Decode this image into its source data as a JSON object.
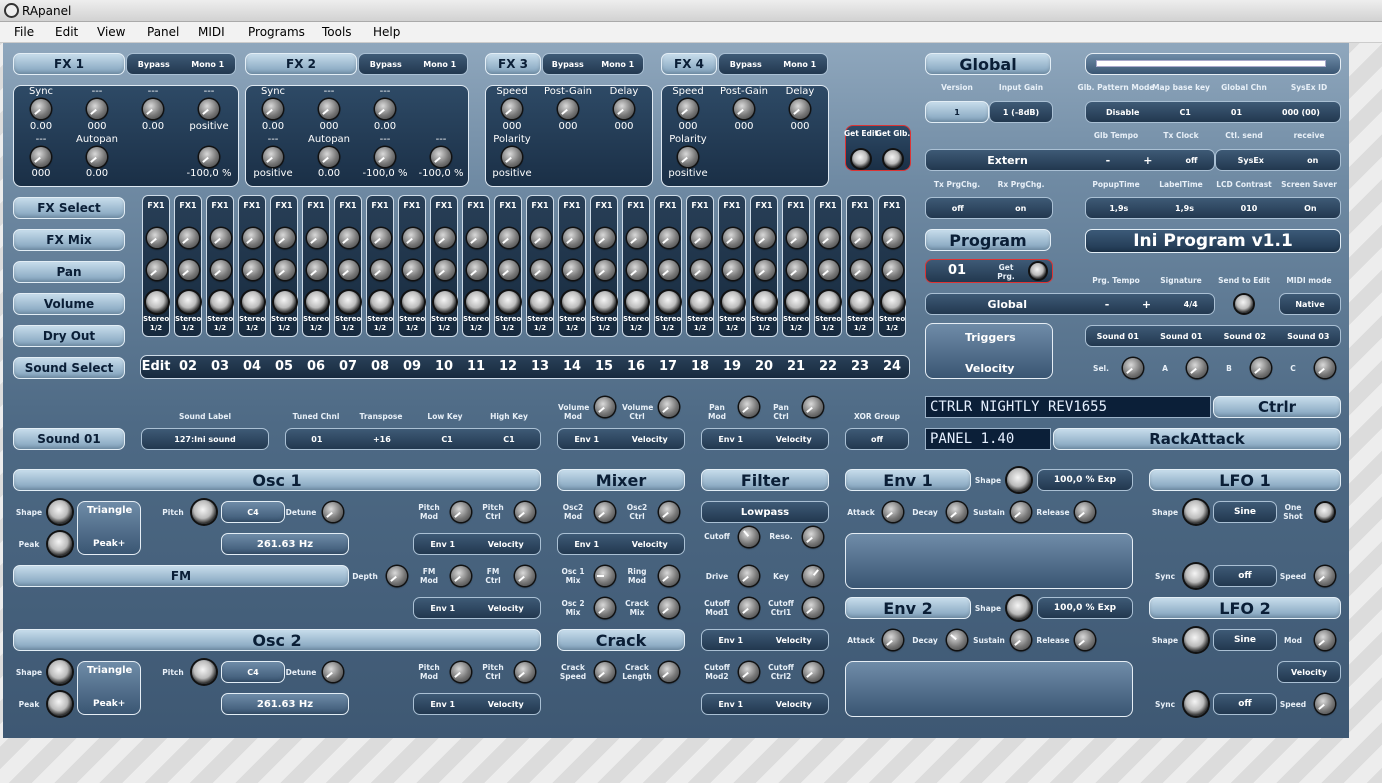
{
  "window": {
    "title": "RApanel"
  },
  "menu": [
    "File",
    "Edit",
    "View",
    "Panel",
    "MIDI",
    "Programs",
    "Tools",
    "Help"
  ],
  "fx": {
    "fx1": {
      "title": "FX 1",
      "bypass": "Bypass",
      "mono": "Mono 1",
      "labels_row1": [
        "Sync",
        "---",
        "---",
        "---"
      ],
      "values_row1": [
        "0.00",
        "000",
        "0.00",
        "positive"
      ],
      "labels_row2": [
        "---",
        "Autopan",
        "",
        ""
      ],
      "values_row2": [
        "000",
        "0.00",
        "",
        "-100,0 %"
      ]
    },
    "fx2": {
      "title": "FX 2",
      "bypass": "Bypass",
      "mono": "Mono 1",
      "labels_row1": [
        "Sync",
        "---",
        "---"
      ],
      "values_row1": [
        "0.00",
        "000",
        "0.00"
      ],
      "labels_row2": [
        "---",
        "Autopan",
        "---",
        "---"
      ],
      "values_row2": [
        "positive",
        "0.00",
        "-100,0 %",
        "-100,0 %"
      ]
    },
    "fx3": {
      "title": "FX 3",
      "bypass": "Bypass",
      "mono": "Mono 1",
      "labels": [
        "Speed",
        "Post-Gain",
        "Delay"
      ],
      "values": [
        "000",
        "000",
        "000"
      ],
      "polarity_label": "Polarity",
      "polarity_value": "positive"
    },
    "fx4": {
      "title": "FX 4",
      "bypass": "Bypass",
      "mono": "Mono 1",
      "labels": [
        "Speed",
        "Post-Gain",
        "Delay"
      ],
      "values": [
        "000",
        "000",
        "000"
      ],
      "polarity_label": "Polarity",
      "polarity_value": "positive"
    },
    "get_edit": "Get Edit",
    "get_glb": "Get Glb."
  },
  "mixer_buttons": [
    "FX Select",
    "FX Mix",
    "Pan",
    "Volume",
    "Dry Out",
    "Sound Select"
  ],
  "strip": {
    "fx_label": "FX1",
    "stereo": "Stereo",
    "half": "1/2",
    "numbers": [
      "Edit",
      "02",
      "03",
      "04",
      "05",
      "06",
      "07",
      "08",
      "09",
      "10",
      "11",
      "12",
      "13",
      "14",
      "15",
      "16",
      "17",
      "18",
      "19",
      "20",
      "21",
      "22",
      "23",
      "24"
    ]
  },
  "global": {
    "title": "Global",
    "version_label": "Version",
    "version": "1",
    "input_gain_label": "Input Gain",
    "input_gain": "1 (-8dB)",
    "glb_pattern_mode_label": "Glb. Pattern Mode",
    "glb_pattern_mode": "Disable",
    "map_base_key_label": "Map base key",
    "map_base_key": "C1",
    "global_chn_label": "Global Chn",
    "global_chn": "01",
    "sysex_id_label": "SysEx ID",
    "sysex_id": "000 (00)",
    "glb_tempo_label": "Glb Tempo",
    "tx_clock_label": "Tx Clock",
    "ctl_send_label": "Ctl. send",
    "receive_label": "receive",
    "extern": "Extern",
    "minus": "-",
    "plus": "+",
    "tx_clock": "off",
    "ctl_send": "SysEx",
    "receive": "on",
    "tx_prgchg_label": "Tx PrgChg.",
    "tx_prgchg": "off",
    "rx_prgchg_label": "Rx PrgChg.",
    "rx_prgchg": "on",
    "popup_time_label": "PopupTime",
    "popup_time": "1,9s",
    "label_time_label": "LabelTime",
    "label_time": "1,9s",
    "lcd_contrast_label": "LCD Contrast",
    "lcd_contrast": "010",
    "screen_saver_label": "Screen Saver",
    "screen_saver": "On"
  },
  "program": {
    "title": "Program",
    "number": "01",
    "get_prg": "Get Prg.",
    "name": "Ini Program v1.1",
    "prg_tempo_label": "Prg. Tempo",
    "signature_label": "Signature",
    "signature": "4/4",
    "send_to_edit_label": "Send to Edit",
    "midi_mode_label": "MIDI mode",
    "midi_mode": "Native",
    "tempo_source": "Global",
    "triggers": "Triggers",
    "velocity": "Velocity",
    "sounds": [
      "Sound 01",
      "Sound 01",
      "Sound 02",
      "Sound 03"
    ],
    "sel_label": "Sel.",
    "abc": [
      "A",
      "B",
      "C"
    ]
  },
  "ctrlr": {
    "lcd1": "CTRLR NIGHTLY REV1655",
    "lcd2": "PANEL 1.40",
    "ctrlr_btn": "Ctrlr",
    "rackattack": "RackAttack"
  },
  "sound": {
    "name": "Sound 01",
    "sound_label_label": "Sound Label",
    "sound_label": "127:Ini sound",
    "tuned_chnl_label": "Tuned Chnl",
    "tuned_chnl": "01",
    "transpose_label": "Transpose",
    "transpose": "+16",
    "low_key_label": "Low Key",
    "low_key": "C1",
    "high_key_label": "High Key",
    "high_key": "C1",
    "volume_mod": "Volume Mod",
    "volume_ctrl": "Volume Ctrl",
    "pan_mod": "Pan Mod",
    "pan_ctrl": "Pan Ctrl",
    "xor_group_label": "XOR Group",
    "xor_group": "off",
    "env1": "Env 1",
    "velocity": "Velocity"
  },
  "osc1": {
    "title": "Osc 1",
    "shape_label": "Shape",
    "peak_label": "Peak",
    "shape": "Triangle",
    "peak": "Peak+",
    "pitch_label": "Pitch",
    "pitch": "C4",
    "detune_label": "Detune",
    "freq": "261.63 Hz",
    "mode": "FM",
    "depth_label": "Depth",
    "pitch_mod": "Pitch Mod",
    "pitch_ctrl": "Pitch Ctrl",
    "fm_mod": "FM Mod",
    "fm_ctrl": "FM Ctrl"
  },
  "osc2": {
    "title": "Osc 2",
    "shape_label": "Shape",
    "peak_label": "Peak",
    "shape": "Triangle",
    "peak": "Peak+",
    "pitch_label": "Pitch",
    "pitch": "C4",
    "detune_label": "Detune",
    "freq": "261.63 Hz",
    "pitch_mod": "Pitch Mod",
    "pitch_ctrl": "Pitch Ctrl"
  },
  "mixer": {
    "title": "Mixer",
    "osc2_mod": "Osc2 Mod",
    "osc2_ctrl": "Osc2 Ctrl",
    "osc1_mix": "Osc 1 Mix",
    "ring_mod": "Ring Mod",
    "osc2_mix": "Osc 2 Mix",
    "crack_mix": "Crack Mix"
  },
  "crack": {
    "title": "Crack",
    "speed": "Crack Speed",
    "length": "Crack Length"
  },
  "filter": {
    "title": "Filter",
    "type": "Lowpass",
    "cutoff": "Cutoff",
    "reso": "Reso.",
    "drive": "Drive",
    "key": "Key",
    "cutoff_mod1": "Cutoff Mod1",
    "cutoff_ctrl1": "Cutoff Ctrl1",
    "cutoff_mod2": "Cutoff Mod2",
    "cutoff_ctrl2": "Cutoff Ctrl2"
  },
  "env1": {
    "title": "Env 1",
    "shape_label": "Shape",
    "shape": "100,0 % Exp",
    "attack": "Attack",
    "decay": "Decay",
    "sustain": "Sustain",
    "release": "Release"
  },
  "env2": {
    "title": "Env 2",
    "shape_label": "Shape",
    "shape": "100,0 % Exp",
    "attack": "Attack",
    "decay": "Decay",
    "sustain": "Sustain",
    "release": "Release"
  },
  "lfo1": {
    "title": "LFO 1",
    "shape_label": "Shape",
    "shape": "Sine",
    "one_shot": "One Shot",
    "sync_label": "Sync",
    "sync": "off",
    "speed_label": "Speed"
  },
  "lfo2": {
    "title": "LFO 2",
    "shape_label": "Shape",
    "shape": "Sine",
    "mod_label": "Mod",
    "mod_source": "Velocity",
    "sync_label": "Sync",
    "sync": "off",
    "speed_label": "Speed"
  }
}
